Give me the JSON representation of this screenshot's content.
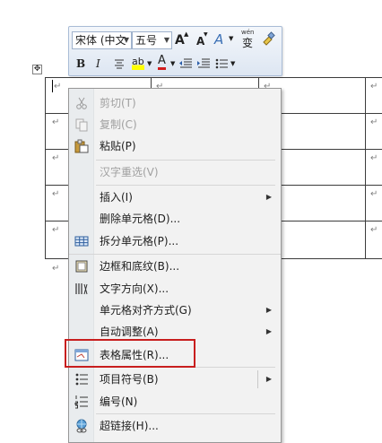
{
  "minibar": {
    "font_name": "宋体 (中文",
    "font_size": "五号",
    "grow_font": "A",
    "shrink_font": "A",
    "styles_glyph": "A",
    "phonetic_glyph": "wén",
    "phonetic_char": "变",
    "bold": "B",
    "italic": "I",
    "highlight": "ab",
    "font_color": "A"
  },
  "document": {
    "paragraph_mark": "↵"
  },
  "context_menu": {
    "items": [
      {
        "label": "剪切(T)",
        "disabled": true
      },
      {
        "label": "复制(C)",
        "disabled": true
      },
      {
        "label": "粘贴(P)",
        "disabled": false
      },
      {
        "label": "汉字重选(V)",
        "disabled": true
      },
      {
        "label": "插入(I)",
        "disabled": false,
        "submenu": true
      },
      {
        "label": "删除单元格(D)...",
        "disabled": false
      },
      {
        "label": "拆分单元格(P)...",
        "disabled": false
      },
      {
        "label": "边框和底纹(B)...",
        "disabled": false
      },
      {
        "label": "文字方向(X)...",
        "disabled": false
      },
      {
        "label": "单元格对齐方式(G)",
        "disabled": false,
        "submenu": true
      },
      {
        "label": "自动调整(A)",
        "disabled": false,
        "submenu": true
      },
      {
        "label": "表格属性(R)...",
        "disabled": false,
        "highlighted": true
      },
      {
        "label": "项目符号(B)",
        "disabled": false,
        "submenu": true
      },
      {
        "label": "编号(N)",
        "disabled": false
      },
      {
        "label": "超链接(H)...",
        "disabled": false
      }
    ]
  },
  "colors": {
    "highlight_box": "#c81e1e",
    "menu_bg": "#f2f2f2",
    "table_border": "#3c3c3c"
  }
}
